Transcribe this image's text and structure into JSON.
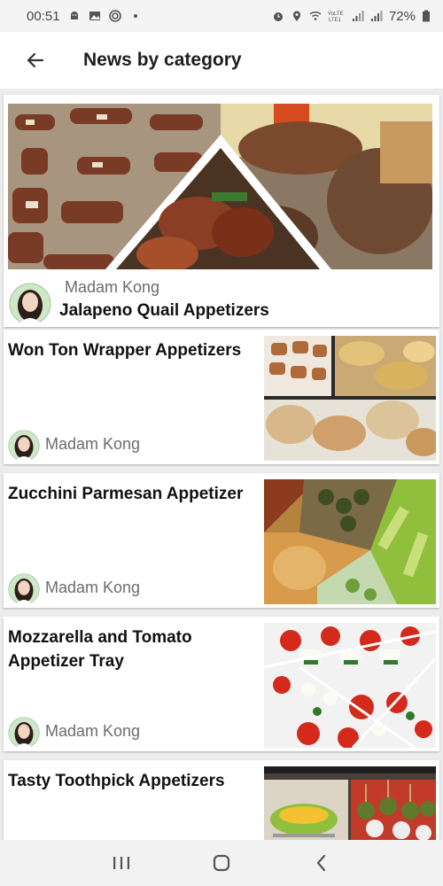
{
  "status_bar": {
    "time": "00:51",
    "left_icons": [
      "android-debug-icon",
      "image-icon",
      "target-icon",
      "dot-icon"
    ],
    "right_icons": [
      "alarm-icon",
      "location-icon",
      "wifi-icon",
      "volte-lte-icon",
      "signal-icon",
      "signal-icon"
    ],
    "battery": "72%"
  },
  "app_bar": {
    "back_icon": "arrow-left-icon",
    "title": "News by category"
  },
  "hero": {
    "author": "Madam Kong",
    "title": "Jalapeno Quail Appetizers"
  },
  "articles": [
    {
      "title": "Won Ton Wrapper Appetizers",
      "author": "Madam Kong"
    },
    {
      "title": "Zucchini Parmesan Appetizer",
      "author": "Madam Kong"
    },
    {
      "title": "Mozzarella and Tomato Appetizer Tray",
      "author": "Madam Kong"
    },
    {
      "title": "Tasty Toothpick Appetizers",
      "author": ""
    }
  ],
  "nav_bar": {
    "icons": [
      "recents-icon",
      "home-icon",
      "back-icon"
    ]
  },
  "colors": {
    "background": "#ececec",
    "card": "#ffffff",
    "title_text": "#1e1e1e",
    "author_text": "#6c6c6c"
  }
}
